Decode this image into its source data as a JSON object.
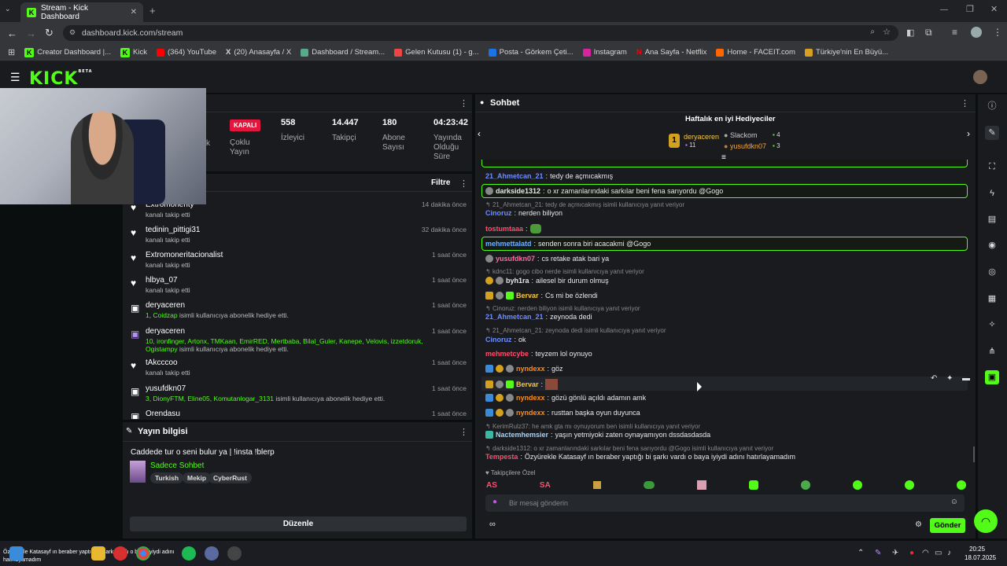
{
  "browser": {
    "tab_title": "Stream - Kick Dashboard",
    "url": "dashboard.kick.com/stream",
    "bookmarks": [
      "Creator Dashboard |...",
      "Kick",
      "(364) YouTube",
      "(20) Anasayfa / X",
      "Dashboard / Stream...",
      "Gelen Kutusu (1) - g...",
      "Posta - Görkem Çeti...",
      "Instagram",
      "Ana Sayfa - Netflix",
      "Home - FACEIT.com",
      "Türkiye'nin En Büyü..."
    ]
  },
  "app": {
    "logo": "KICK",
    "logo_sup": "BETA"
  },
  "stats": {
    "k_label": "k",
    "status_badge": "KAPALI",
    "multistream": "Çoklu Yayın",
    "viewers_value": "558",
    "viewers_label": "İzleyici",
    "followers_value": "14.447",
    "followers_label": "Takipçi",
    "subs_value": "180",
    "subs_label": "Abone Sayısı",
    "uptime_value": "04:23:42",
    "uptime_label": "Yayında Olduğu Süre"
  },
  "activity": {
    "filter_label": "Filtre",
    "items": [
      {
        "name": "Extromonerity",
        "sub": "kanalı takip etti",
        "time": "14 dakika önce"
      },
      {
        "name": "tedinin_pittigi31",
        "sub": "kanalı takip etti",
        "time": "32 dakika önce"
      },
      {
        "name": "Extromoneritacionalist",
        "sub": "kanalı takip etti",
        "time": "1 saat önce"
      },
      {
        "name": "hlbya_07",
        "sub": "kanalı takip etti",
        "time": "1 saat önce"
      },
      {
        "name": "deryaceren",
        "sub_green": "1, Coidzap",
        "sub": "isimli kullanıcıya abonelik hediye etti.",
        "time": "1 saat önce"
      },
      {
        "name": "deryaceren",
        "sub_green": "10, ironfinger, Artonx, TMKaan, EmirRED, Mertbaba, Bilal_Guler, Kanepe, Velovis, izzetdoruk, Ogistampy",
        "sub": "isimli kullanıcıya abonelik hediye etti.",
        "time": "1 saat önce"
      },
      {
        "name": "tAkcccoo",
        "sub": "kanalı takip etti",
        "time": "1 saat önce"
      },
      {
        "name": "yusufdkn07",
        "sub_green": "3, DionyFTM, Eline05, Komutanlogar_3131",
        "sub": "isimli kullanıcıya abonelik hediye etti.",
        "time": "1 saat önce"
      },
      {
        "name": "Orendasu",
        "sub": "",
        "time": "1 saat önce"
      }
    ]
  },
  "stream_info": {
    "title": "Yayın bilgisi",
    "stream_title": "Caddede tur o seni bulur ya | !insta !blerp",
    "category": "Sadece Sohbet",
    "tags": [
      "Turkish",
      "Mekip",
      "CyberRust"
    ],
    "edit_button": "Düzenle"
  },
  "chat": {
    "title": "Sohbet",
    "gifters_title": "Haftalık en iyi Hediyeciler",
    "gifters": [
      {
        "rank": "1",
        "name": "deryaceren",
        "count": "11"
      },
      {
        "name": "Slackom",
        "count": "4"
      },
      {
        "name": "yusufdkn07",
        "count": "3"
      }
    ],
    "messages": [
      {
        "user": "21_Ahmetcan_21",
        "color": "#6f8cff",
        "text": "tedy de açmıcakmış"
      },
      {
        "user": "darkside1312",
        "color": "#e8e8e8",
        "text": "o xr zamanlarındaki sarkılar beni fena sarıyordu @Gogo"
      },
      {
        "reply": "21_Ahmetcan_21: tedy de açmıcakmış isimli kullanıcıya yanıt veriyor"
      },
      {
        "user": "Cinoruz",
        "color": "#6f8cff",
        "text": "nerden biliyon"
      },
      {
        "user": "tostumtaaa",
        "color": "#ff4d6d",
        "text": ""
      },
      {
        "user": "mehmettalatd",
        "color": "#6fb0ff",
        "text": "senden sonra biri acacakmi @Gogo"
      },
      {
        "user": "yusufdkn07",
        "color": "#ff6aa0",
        "text": "cs retake atak bari ya"
      },
      {
        "reply": "kdnc11: gogo cibo nerde isimli kullanıcıya yanıt veriyor"
      },
      {
        "user": "byh1ra",
        "color": "#e8e8e8",
        "text": "ailesel bir durum olmuş"
      },
      {
        "user": "Bervar",
        "color": "#f5c542",
        "text": "Cs mi be özlendi"
      },
      {
        "reply": "Cinoruz: nerden biliyon isimli kullanıcıya yanıt veriyor"
      },
      {
        "user": "21_Ahmetcan_21",
        "color": "#6f8cff",
        "text": "zeynoda dedi"
      },
      {
        "reply": "21_Ahmetcan_21: zeynoda dedi isimli kullanıcıya yanıt veriyor"
      },
      {
        "user": "Cinoruz",
        "color": "#6f8cff",
        "text": "ok"
      },
      {
        "user": "mehmetcybe",
        "color": "#ff4d6d",
        "text": "teyzem lol oynuyo"
      },
      {
        "user": "nyndexx",
        "color": "#ff8c1a",
        "text": "göz"
      },
      {
        "user": "Bervar",
        "color": "#f5c542",
        "text": ""
      },
      {
        "user": "nyndexx",
        "color": "#ff8c1a",
        "text": "gözü gönlü açıldı adamın amk"
      },
      {
        "user": "nyndexx",
        "color": "#ff8c1a",
        "text": "rusttan başka oyun duyunca"
      },
      {
        "reply": "KerimRulz37: he amk gta mı oynuyorum ben isimli kullanıcıya yanıt veriyor"
      },
      {
        "user": "Nactemhemsier",
        "color": "#9fd4ff",
        "text": "yaşın yetmiyoki zaten oynayamıyon dssdasdasda"
      },
      {
        "reply": "darkside1312: o xr zamanlarındaki sarkılar beni fena sarıyordu @Gogo isimli kullanıcıya yanıt veriyor"
      },
      {
        "user": "Tempesta",
        "color": "#ff4d6d",
        "text": "Özyürekle Katasayf ın beraber yaptığı bi şarkı vardı o baya iyiydi adını hatırlayamadım"
      }
    ],
    "emote_label": "Takipçilere Özel",
    "input_placeholder": "Bir mesaj gönderin",
    "send_button": "Gönder"
  },
  "taskbar": {
    "ticker": "Özyürekle Katasayf ın beraber yaptığı bi şarkı vardı o baya iyiydi adını hatırlayamadım",
    "time": "20:25",
    "date": "18.07.2025"
  },
  "colors": {
    "accent": "#53fc18",
    "panel": "#191b1f",
    "bg": "#0b0e0f",
    "live_badge": "#e3173e"
  }
}
